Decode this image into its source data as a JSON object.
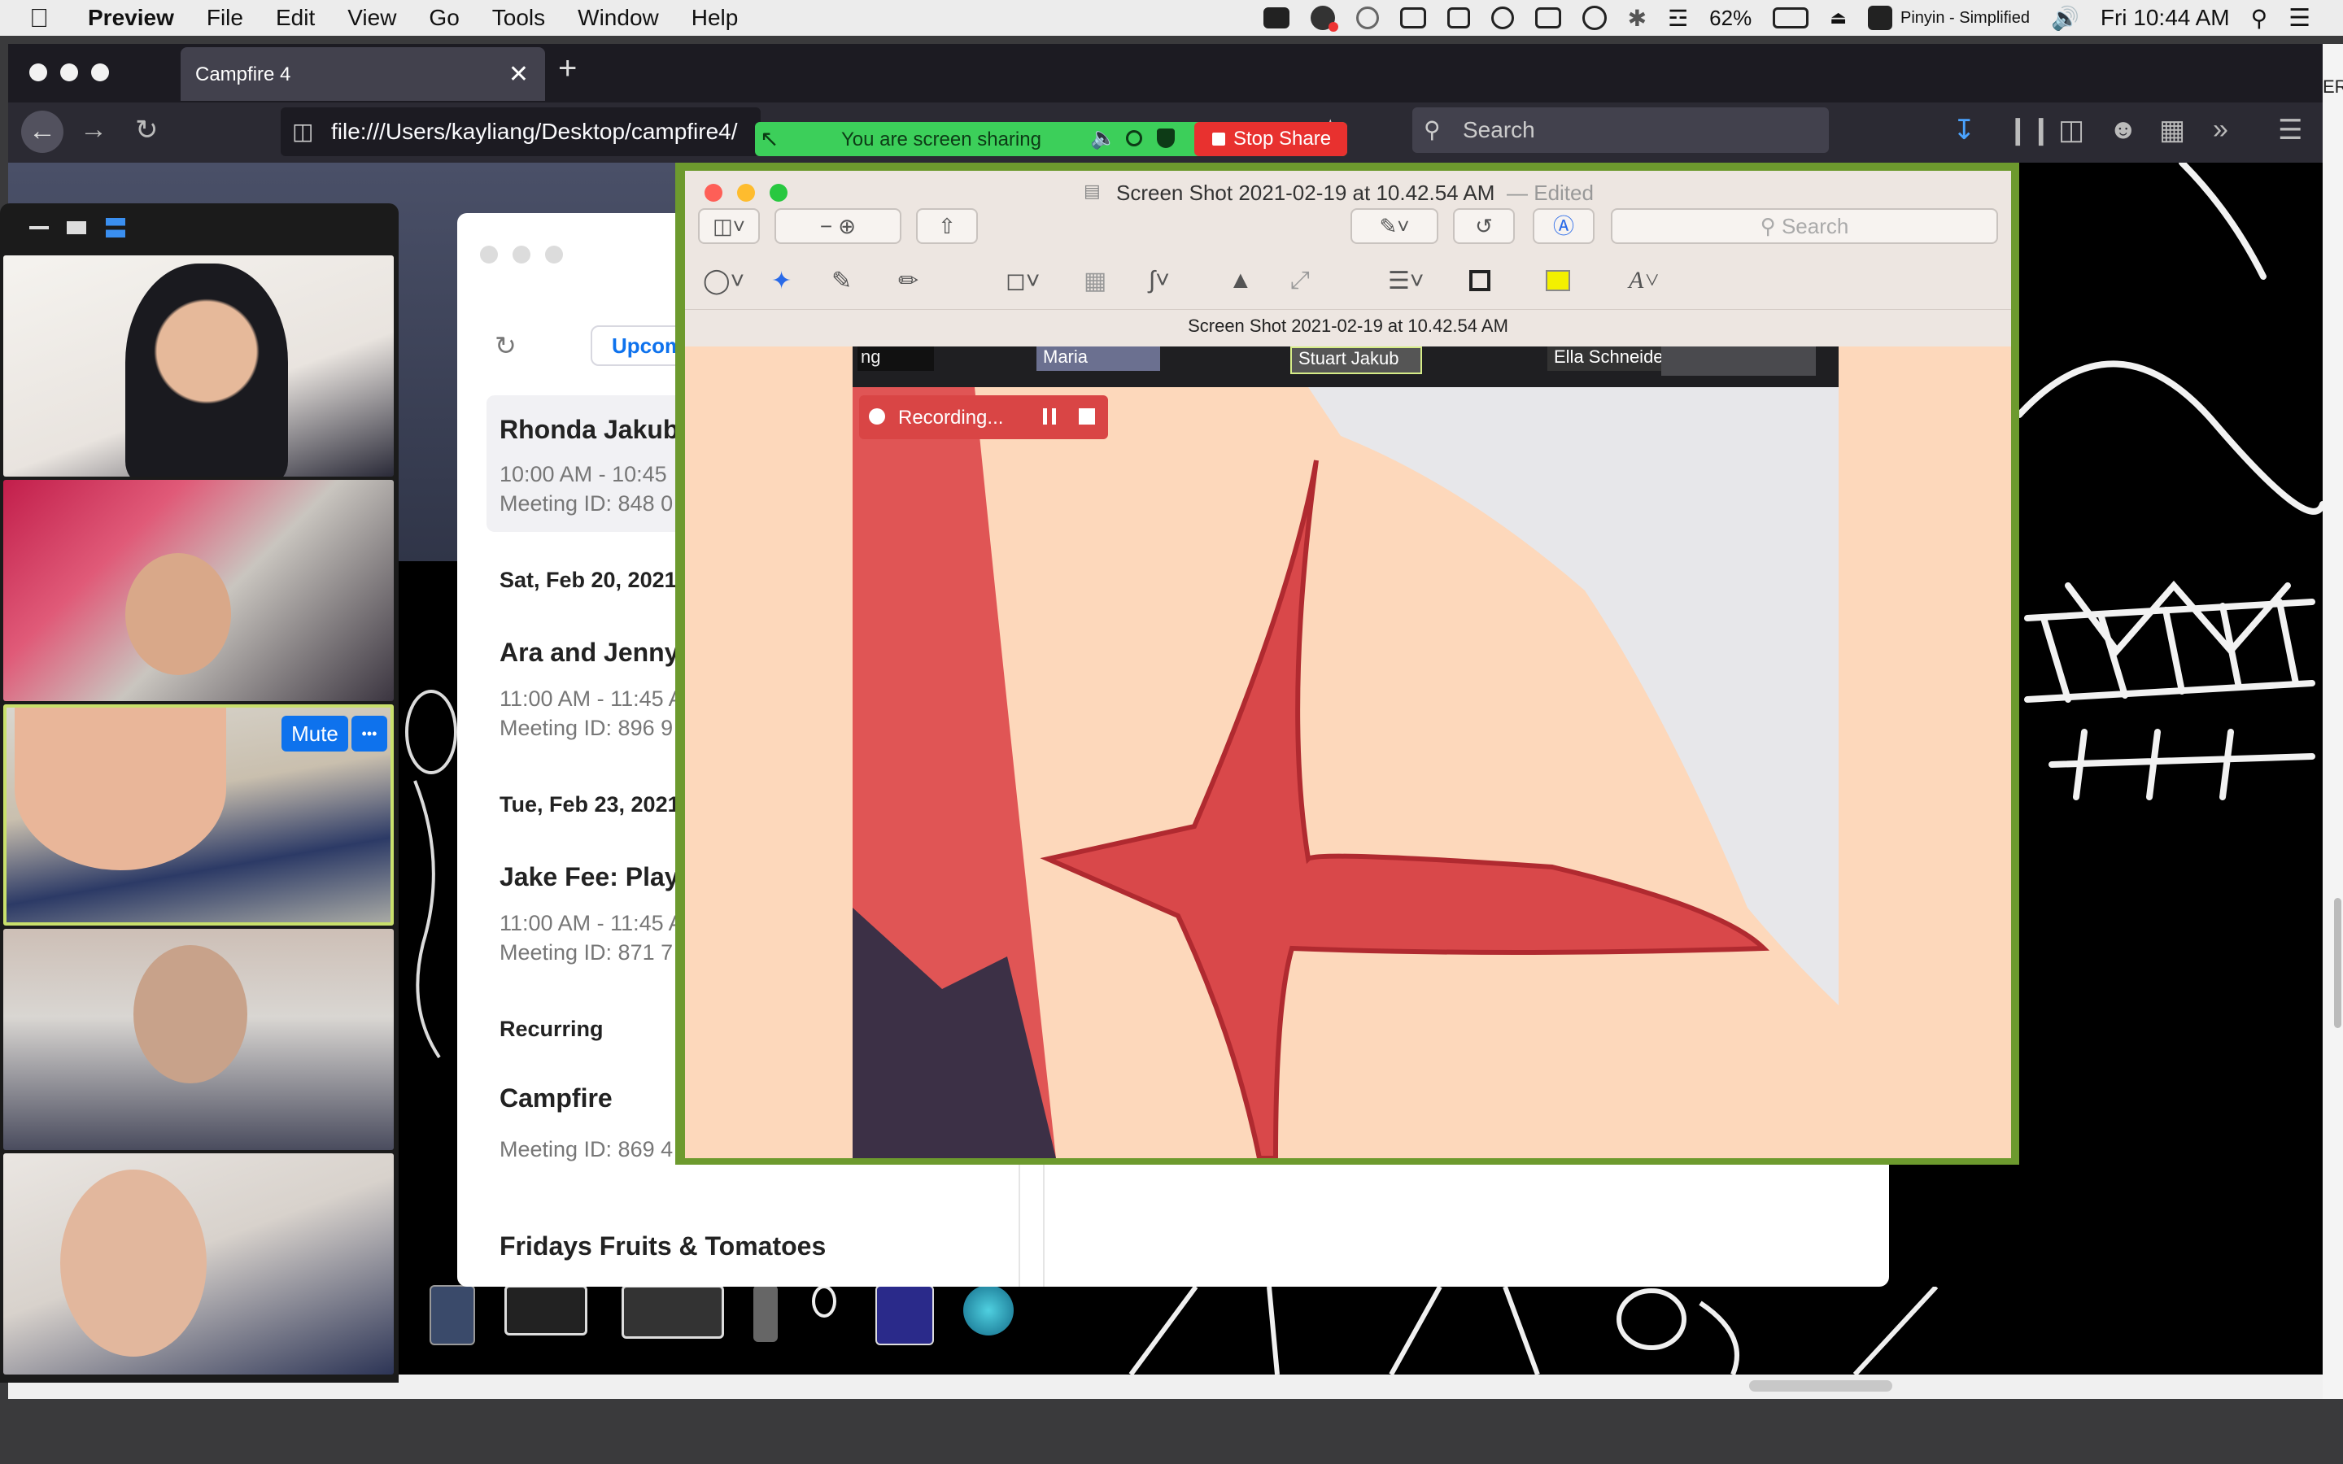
{
  "menubar": {
    "app": "Preview",
    "items": [
      "File",
      "Edit",
      "View",
      "Go",
      "Tools",
      "Window",
      "Help"
    ],
    "battery": "62%",
    "input_method": "Pinyin - Simplified",
    "clock": "Fri 10:44 AM"
  },
  "browser": {
    "tab_title": "Campfire 4",
    "new_tab": "+",
    "close_tab": "✕",
    "url": "file:///Users/kayliang/Desktop/campfire4/",
    "search_placeholder": "Search"
  },
  "share": {
    "banner_text": "You are screen sharing",
    "stop_label": "Stop Share"
  },
  "gallery": {
    "mute_label": "Mute",
    "more_label": "•••"
  },
  "meetings": {
    "tab_upcoming": "Upcoming",
    "items": [
      {
        "title": "Rhonda Jakub",
        "time": "10:00 AM - 10:45",
        "meeting_id": "Meeting ID: 848 0"
      },
      {
        "date": "Sat, Feb 20, 2021"
      },
      {
        "title": "Ara and Jenny",
        "time": "11:00 AM - 11:45 A",
        "meeting_id": "Meeting ID: 896 9"
      },
      {
        "date": "Tue, Feb 23, 2021"
      },
      {
        "title": "Jake Fee: Play",
        "time": "11:00 AM - 11:45 A",
        "meeting_id": "Meeting ID: 871 7"
      },
      {
        "section": "Recurring"
      },
      {
        "title": "Campfire",
        "meeting_id": "Meeting ID: 869 4"
      },
      {
        "title": "Fridays Fruits & Tomatoes"
      }
    ]
  },
  "preview": {
    "title": "Screen Shot 2021-02-19 at 10.42.54 AM",
    "edited": "— Edited",
    "doc_label": "Screen Shot 2021-02-19 at 10.42.54 AM",
    "search_placeholder": "Search",
    "name_labels": [
      "ng",
      "Maria",
      "Stuart Jakub",
      "Ella Schneider"
    ],
    "recording_label": "Recording..."
  },
  "right_edge_text": "ER",
  "colors": {
    "share_green": "#3ccf5a",
    "stop_red": "#e8312f",
    "preview_border": "#6d9a2e",
    "canvas_peach": "#fdd8bb",
    "drawing_red": "#d9484a",
    "zoom_blue": "#0e72ed"
  }
}
